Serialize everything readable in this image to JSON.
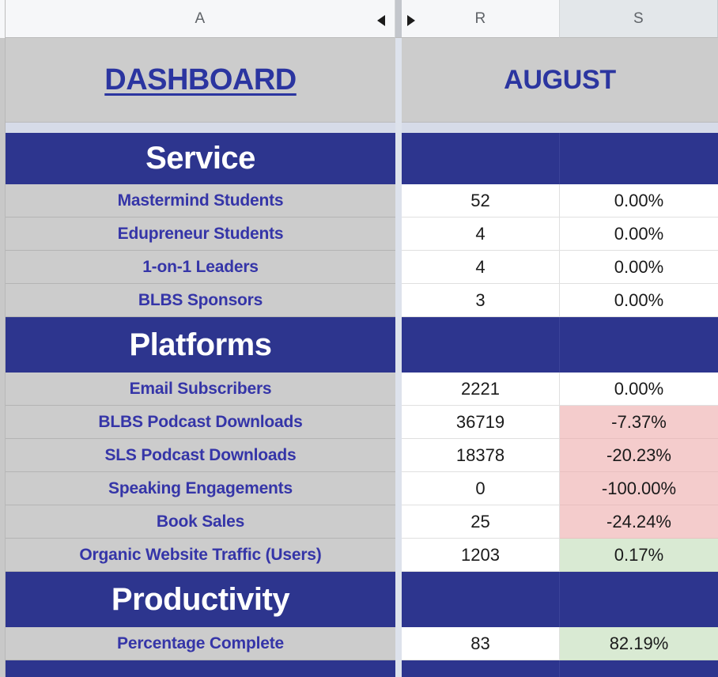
{
  "app": {
    "type": "spreadsheet",
    "colors": {
      "section_blue": "#2D358E",
      "label_gray": "#CCCCCC",
      "label_text_blue": "#3535A8",
      "negative_red_bg": "#F4CCCC",
      "positive_green_bg": "#D9EAD3",
      "pane_gap": "#DDE2EC",
      "header_bg": "#F6F7F9",
      "header_selected_bg": "#E3E7EA"
    }
  },
  "column_headers": [
    {
      "id": "col-a",
      "label": "A",
      "selected": false,
      "hidden_marker": "collapse-left-arrow"
    },
    {
      "id": "col-r",
      "label": "R",
      "selected": false,
      "hidden_marker": "collapse-right-arrow"
    },
    {
      "id": "col-s",
      "label": "S",
      "selected": true,
      "hidden_marker": ""
    }
  ],
  "title_row": {
    "dashboard_label": "DASHBOARD",
    "month_label": "AUGUST"
  },
  "sections": [
    {
      "name": "Service",
      "rows": [
        {
          "label": "Mastermind Students",
          "value": "52",
          "percent": "0.00%",
          "percent_state": "neutral"
        },
        {
          "label": "Edupreneur Students",
          "value": "4",
          "percent": "0.00%",
          "percent_state": "neutral"
        },
        {
          "label": "1-on-1 Leaders",
          "value": "4",
          "percent": "0.00%",
          "percent_state": "neutral"
        },
        {
          "label": "BLBS Sponsors",
          "value": "3",
          "percent": "0.00%",
          "percent_state": "neutral"
        }
      ]
    },
    {
      "name": "Platforms",
      "rows": [
        {
          "label": "Email Subscribers",
          "value": "2221",
          "percent": "0.00%",
          "percent_state": "neutral"
        },
        {
          "label": "BLBS Podcast Downloads",
          "value": "36719",
          "percent": "-7.37%",
          "percent_state": "negative"
        },
        {
          "label": "SLS Podcast Downloads",
          "value": "18378",
          "percent": "-20.23%",
          "percent_state": "negative"
        },
        {
          "label": "Speaking Engagements",
          "value": "0",
          "percent": "-100.00%",
          "percent_state": "negative"
        },
        {
          "label": "Book Sales",
          "value": "25",
          "percent": "-24.24%",
          "percent_state": "negative"
        },
        {
          "label": "Organic Website Traffic (Users)",
          "value": "1203",
          "percent": "0.17%",
          "percent_state": "positive"
        }
      ]
    },
    {
      "name": "Productivity",
      "rows": [
        {
          "label": "Percentage Complete",
          "value": "83",
          "percent": "82.19%",
          "percent_state": "positive"
        }
      ]
    },
    {
      "name": "",
      "rows": []
    }
  ]
}
